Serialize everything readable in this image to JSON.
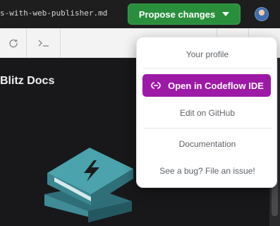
{
  "header": {
    "filename": "s-with-web-publisher.md",
    "propose_label": "Propose changes"
  },
  "preview": {
    "title": "Blitz Docs"
  },
  "menu": {
    "your_profile": "Your profile",
    "open_codeflow": "Open in Codeflow IDE",
    "edit_github": "Edit on GitHub",
    "documentation": "Documentation",
    "report_bug": "See a bug? File an issue!"
  },
  "colors": {
    "propose_green": "#2a8f3c",
    "codeflow_purple": "#9c1aa6",
    "books_teal": "#3f8c97"
  }
}
